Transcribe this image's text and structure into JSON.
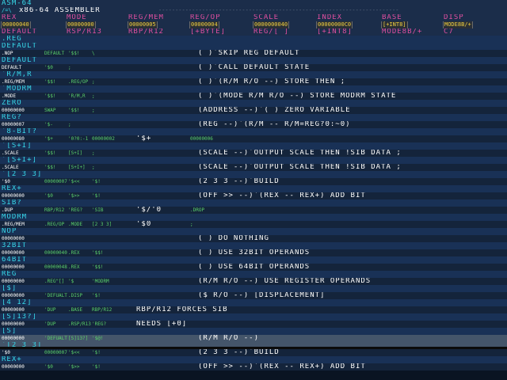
{
  "title": "ASM-64",
  "subtitle": "x86-64 ASSEMBLER",
  "header_cols": [
    "REX",
    "MODE",
    "REG/MEM",
    "REG/OP",
    "SCALE",
    "INDEX",
    "BASE",
    "DISP"
  ],
  "header_vals": [
    "00000040",
    "00000000",
    "00000005",
    "00000004",
    "0000000040",
    "00000000C0",
    "[+INT8]",
    "MODE8B/+"
  ],
  "header_vals2": [
    "DEFAULT",
    "RSP/R13",
    "RBP/R12",
    "[+BYTE]",
    "REG/[ ]",
    "[+INT8]",
    "MODE8B/+",
    "C7"
  ],
  "lines": [
    {
      "a": ".REG",
      "b": "",
      "c": "",
      "d": "",
      "e": "",
      "f": ""
    },
    {
      "a": "DEFAULT",
      "b": "",
      "c": "",
      "d": "",
      "e": "",
      "f": ""
    },
    {
      "a": ".NOP",
      "b": "DEFAULT",
      "c": "'$$!",
      "d": "\\",
      "e": "( )`SKIP REG DEFAULT",
      "f": ""
    },
    {
      "a": "DEFAULT",
      "b": "",
      "c": "",
      "d": "",
      "e": "",
      "f": ""
    },
    {
      "a": "DEFAULT",
      "b": "'$0",
      "c": ";",
      "d": "",
      "e": "( )`CALL DEFAULT STATE",
      "f": ""
    },
    {
      "a": "`R/M,R",
      "b": "",
      "c": "",
      "d": "",
      "e": "",
      "f": ""
    },
    {
      "a": ".REG/MEM",
      "b": "'$$!",
      "c": ".REG/OP",
      "d": ";",
      "e": "( )`(R/M R/O --) STORE THEN ;",
      "f": ""
    },
    {
      "a": "`MODRM",
      "b": "",
      "c": "",
      "d": "",
      "e": "",
      "f": ""
    },
    {
      "a": ".MODE",
      "b": "'$$!",
      "c": "'R/M,R",
      "d": ";",
      "e": "( )`(MODE R/M R/O --) STORE MODRM STATE",
      "f": ""
    },
    {
      "a": "ZERO",
      "b": "",
      "c": "",
      "d": "",
      "e": "",
      "f": ""
    },
    {
      "a": "00000000",
      "b": "SWAP",
      "c": "'$$!",
      "d": ";",
      "e": "(ADDRESS --)`( ) ZERO VARIABLE",
      "f": ""
    },
    {
      "a": "REG?",
      "b": "",
      "c": "",
      "d": "",
      "e": "",
      "f": ""
    },
    {
      "a": "00000007",
      "b": "'$-",
      "c": ";",
      "d": "",
      "e": "(REG --)`(R/M -- R/M=REG?0:~0)",
      "f": ""
    },
    {
      "a": "`8-BIT?",
      "b": "",
      "c": "",
      "d": "",
      "e": "",
      "f": ""
    },
    {
      "a": "00000080",
      "b": "'$+",
      "c": "'0?0:-1",
      "d": "00000002",
      "e": "'$+",
      "f": "00000006"
    },
    {
      "a": "`[S+I]",
      "b": "",
      "c": "",
      "d": "",
      "e": "",
      "f": ""
    },
    {
      "a": ".SCALE",
      "b": "'$$!",
      "c": "[S+I]",
      "d": ";",
      "e": "(SCALE --)`OUTPUT SCALE THEN !SIB DATA ;",
      "f": ""
    },
    {
      "a": "`[S+I+]",
      "b": "",
      "c": "",
      "d": "",
      "e": "",
      "f": ""
    },
    {
      "a": ".SCALE",
      "b": "'$$!",
      "c": "[S+I+]",
      "d": ";",
      "e": "(SCALE --)`OUTPUT SCALE THEN !SIB DATA ;",
      "f": ""
    },
    {
      "a": "`[2 3 3]",
      "b": "",
      "c": "",
      "d": "",
      "e": "",
      "f": ""
    },
    {
      "a": "'$0",
      "b": "00000007",
      "c": "'$<<",
      "d": "'$!",
      "e": "(2 3 3 --)`BUILD",
      "f": ""
    },
    {
      "a": "REX+",
      "b": "",
      "c": "",
      "d": "",
      "e": "",
      "f": ""
    },
    {
      "a": "00000000",
      "b": "'$0",
      "c": "'$>>",
      "d": "'$!",
      "e": "(OFF >> --)`(REX -- REX+) ADD BIT",
      "f": ""
    },
    {
      "a": "SIB?",
      "b": "",
      "c": "",
      "d": "",
      "e": "",
      "f": ""
    },
    {
      "a": ".DUP",
      "b": "RBP/R12",
      "c": "'REG?",
      "d": "'SIB",
      "e": "'$/'0",
      "f": ".DROP"
    },
    {
      "a": "MODRM",
      "b": "",
      "c": "",
      "d": "",
      "e": "",
      "f": ""
    },
    {
      "a": ".REG/MEM",
      "b": ".REG/OP",
      "c": ".MODE",
      "d": "[2 3 3]",
      "e": "'$0",
      "f": ";"
    },
    {
      "a": "NOP",
      "b": "",
      "c": "",
      "d": "",
      "e": "",
      "f": ""
    },
    {
      "a": "00000000",
      "b": "",
      "c": "",
      "d": "",
      "e": "( ) DO NOTHING",
      "f": ""
    },
    {
      "a": "32BIT",
      "b": "",
      "c": "",
      "d": "",
      "e": "",
      "f": ""
    },
    {
      "a": "00000000",
      "b": "00000040",
      "c": ".REX",
      "d": "'$$!",
      "e": "( ) USE 32BIT OPERANDS",
      "f": ""
    },
    {
      "a": "64BIT",
      "b": "",
      "c": "",
      "d": "",
      "e": "",
      "f": ""
    },
    {
      "a": "00000000",
      "b": "00000048",
      "c": ".REX",
      "d": "'$$!",
      "e": "( ) USE 64BIT OPERANDS",
      "f": ""
    },
    {
      "a": "REG",
      "b": "",
      "c": "",
      "d": "",
      "e": "",
      "f": ""
    },
    {
      "a": "00000000",
      "b": ".REG\"[]",
      "c": "'$",
      "d": "'MODRM",
      "e": "(R/M R/O --) USE REGISTER OPERANDS",
      "f": ""
    },
    {
      "a": "[$]",
      "b": "",
      "c": "",
      "d": "",
      "e": "",
      "f": ""
    },
    {
      "a": "00000000",
      "b": "'DEFUALT",
      "c": ".DISP",
      "d": "'$!",
      "e": "($ R/O --) [DISPLACEMENT]",
      "f": ""
    },
    {
      "a": "[4 12]",
      "b": "",
      "c": "",
      "d": "",
      "e": "",
      "f": ""
    },
    {
      "a": "00000000",
      "b": "'DUP",
      "c": ".BASE",
      "d": "RBP/R12",
      "e": "RBP/R12 FORCES SIB",
      "f": ""
    },
    {
      "a": "[S]13?]",
      "b": "",
      "c": "",
      "d": "",
      "e": "",
      "f": ""
    },
    {
      "a": "00000000",
      "b": "'DUP",
      "c": ".RSP/R13",
      "d": "'REG?",
      "e": "NEEDS [+0]",
      "f": ""
    },
    {
      "a": "[S]",
      "b": "",
      "c": "",
      "d": "",
      "e": "",
      "f": ""
    },
    {
      "a": "00000000",
      "b": "'DEFUALT",
      "c": "[S]13?]",
      "d": "'$@!",
      "e": "(R/M R/O --)",
      "f": ""
    },
    {
      "a": "`[2 3 3]",
      "b": "",
      "c": "",
      "d": "",
      "e": "",
      "f": ""
    },
    {
      "a": "'$0",
      "b": "00000007",
      "c": "'$<<",
      "d": "'$!",
      "e": "(2 3 3 --)`BUILD",
      "f": ""
    },
    {
      "a": "REX+",
      "b": "",
      "c": "",
      "d": "",
      "e": "",
      "f": ""
    },
    {
      "a": "00000000",
      "b": "'$0",
      "c": "'$>>",
      "d": "'$!",
      "e": "(OFF >> --)`(REX -- REX+) ADD BIT",
      "f": ""
    }
  ]
}
